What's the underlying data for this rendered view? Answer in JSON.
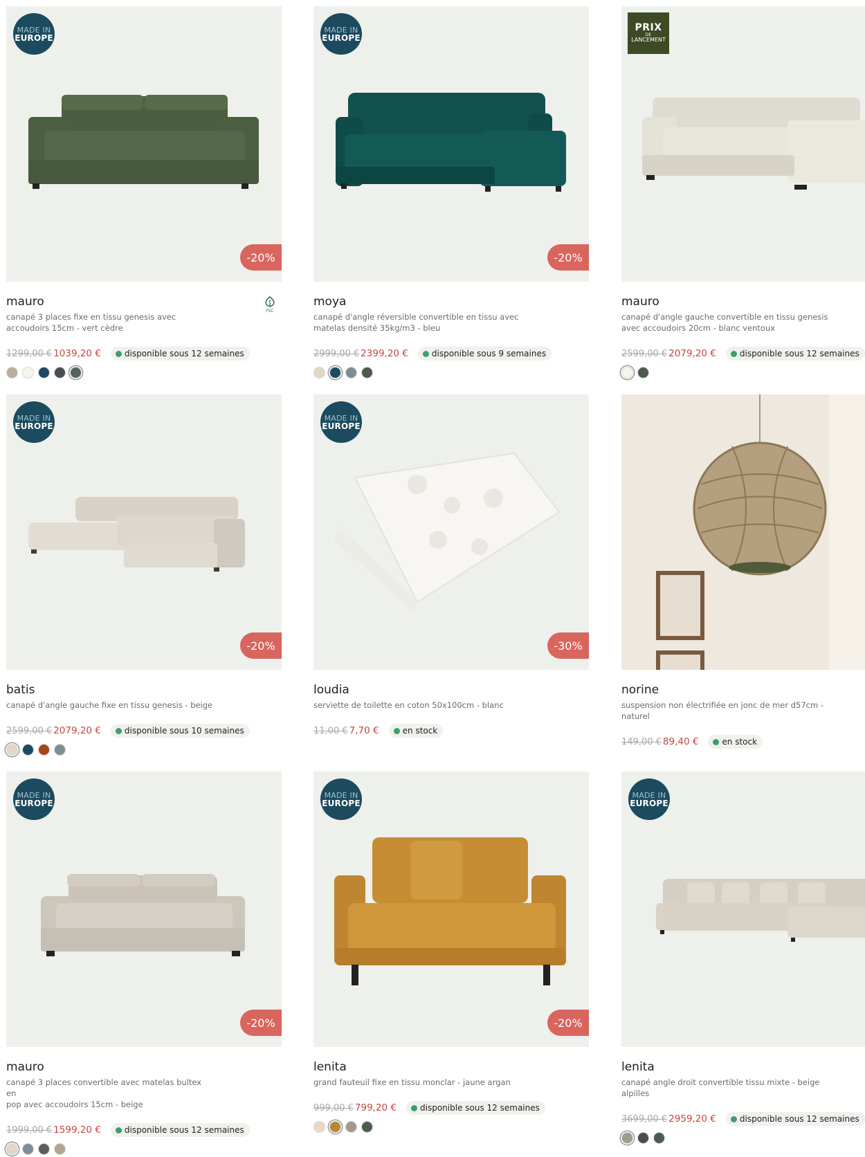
{
  "badges": {
    "eu_line1": "MADE IN",
    "eu_line2": "EUROPE",
    "launch_line1": "PRIX",
    "launch_line2": "DE",
    "launch_line3": "LANCEMENT",
    "fsc": "FSC"
  },
  "products": [
    {
      "name": "mauro",
      "desc_line1": "canapé 3 places fixe en tissu genesis avec",
      "desc_line2": "accoudoirs 15cm - vert cèdre",
      "old_price": "1299,00 €",
      "new_price": "1039,20 €",
      "stock": "disponible sous 12 semaines",
      "discount": "-20%",
      "badge": "eu",
      "fsc": true,
      "swatches": [
        "#b7ae9c",
        "#f6f4ec",
        "#1d4a63",
        "#4a4c4e",
        "#58625c"
      ],
      "selected_swatch": 4,
      "icon": "green-sofa"
    },
    {
      "name": "moya",
      "desc_line1": "canapé d'angle réversible convertible en tissu avec",
      "desc_line2": "matelas densité 35kg/m3 - bleu",
      "old_price": "2999,00 €",
      "new_price": "2399,20 €",
      "stock": "disponible sous 9 semaines",
      "discount": "-20%",
      "badge": "eu",
      "swatches": [
        "#e2d6c4",
        "#1d4a63",
        "#7e8d95",
        "#4e5b4e"
      ],
      "selected_swatch": 1,
      "icon": "teal-corner-sofa"
    },
    {
      "name": "mauro",
      "desc_line1": "canapé d'angle gauche convertible en tissu genesis",
      "desc_line2": "avec accoudoirs 20cm - blanc ventoux",
      "old_price": "2599,00 €",
      "new_price": "2079,20 €",
      "stock": "disponible sous 12 semaines",
      "discount": "",
      "badge": "launch",
      "swatches": [
        "#f6f4ec",
        "#4e5b4e"
      ],
      "selected_swatch": 0,
      "icon": "white-corner-sofa"
    },
    {
      "name": "batis",
      "desc_line1": "canapé d'angle gauche fixe en tissu genesis - beige",
      "desc_line2": "",
      "old_price": "2599,00 €",
      "new_price": "2079,20 €",
      "stock": "disponible sous 10 semaines",
      "discount": "-20%",
      "badge": "eu",
      "swatches": [
        "#e4d6c6",
        "#1d4a63",
        "#a74416",
        "#7e8d95"
      ],
      "selected_swatch": 0,
      "icon": "beige-corner-sofa"
    },
    {
      "name": "loudia",
      "desc_line1": "serviette de toilette en coton 50x100cm - blanc",
      "desc_line2": "",
      "old_price": "11,00 €",
      "new_price": "7,70 €",
      "stock": "en stock",
      "discount": "-30%",
      "badge": "eu",
      "swatches": [],
      "icon": "towel"
    },
    {
      "name": "norine",
      "desc_line1": "suspension non électrifiée en jonc de mer d57cm -",
      "desc_line2": "naturel",
      "old_price": "149,00 €",
      "new_price": "89,40 €",
      "stock": "en stock",
      "discount": "",
      "badge": "",
      "swatches": [],
      "icon": "pendant-lamp"
    },
    {
      "name": "mauro",
      "desc_line1": "canapé 3 places convertible avec matelas bultex en",
      "desc_line2": "pop avec accoudoirs 15cm - beige",
      "old_price": "1999,00 €",
      "new_price": "1599,20 €",
      "stock": "disponible sous 12 semaines",
      "discount": "-20%",
      "badge": "eu",
      "swatches": [
        "#e4d6c6",
        "#7e8d95",
        "#5a5c5e",
        "#b2a58c"
      ],
      "selected_swatch": 0,
      "icon": "beige-sofa"
    },
    {
      "name": "lenita",
      "desc_line1": "grand fauteuil fixe en tissu monclar - jaune argan",
      "desc_line2": "",
      "old_price": "999,00 €",
      "new_price": "799,20 €",
      "stock": "disponible sous 12 semaines",
      "discount": "-20%",
      "badge": "eu",
      "swatches": [
        "#e8d8c4",
        "#b68a2c",
        "#a09a8c",
        "#4e5b4e"
      ],
      "selected_swatch": 1,
      "icon": "mustard-loveseat"
    },
    {
      "name": "lenita",
      "desc_line1": "canapé angle droit convertible tissu mixte - beige",
      "desc_line2": "alpilles",
      "old_price": "3699,00 €",
      "new_price": "2959,20 €",
      "stock": "disponible sous 12 semaines",
      "discount": "",
      "badge": "eu",
      "swatches": [
        "#9c9c90",
        "#4a4c4e",
        "#4e5b4e"
      ],
      "selected_swatch": 0,
      "icon": "beige-large-corner-sofa"
    }
  ]
}
